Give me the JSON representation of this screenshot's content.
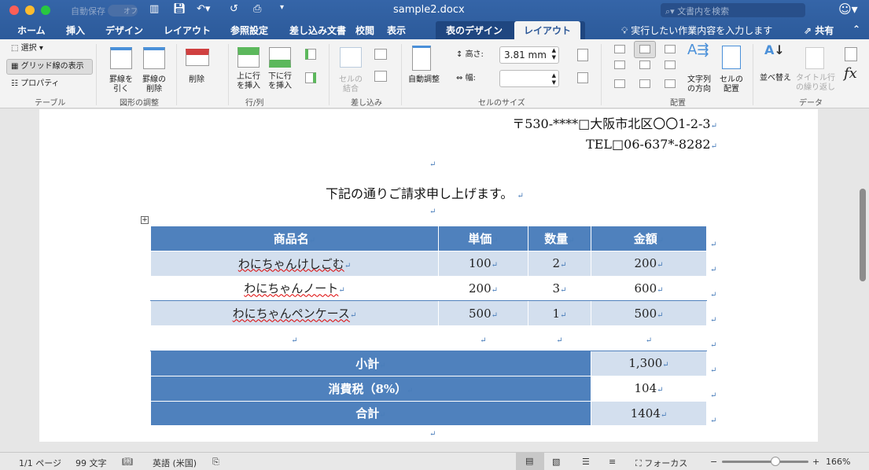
{
  "window": {
    "title": "sample2.docx",
    "autosave_label": "自動保存",
    "autosave_state": "オフ",
    "search_placeholder": "文書内を検索"
  },
  "tabs": [
    "ホーム",
    "挿入",
    "デザイン",
    "レイアウト",
    "参照設定",
    "差し込み文書",
    "校閲",
    "表示",
    "表のデザイン",
    "レイアウト"
  ],
  "active_tab": "レイアウト",
  "tell_me": "実行したい作業内容を入力します",
  "share": "共有",
  "ribbon": {
    "table": {
      "select": "選択",
      "gridlines": "グリッド線の表示",
      "properties": "プロパティ",
      "group": "テーブル"
    },
    "draw": {
      "draw_borders": "罫線を引く",
      "erase_borders": "罫線の削除",
      "group": "図形の調整"
    },
    "rows": {
      "delete": "削除",
      "insert_above": "上に行を挿入",
      "insert_below": "下に行を挿入",
      "group": "行/列"
    },
    "merge": {
      "merge_cells": "セルの結合",
      "group": "差し込み"
    },
    "size": {
      "autofit": "自動調整",
      "height_label": "高さ:",
      "height_value": "3.81 mm",
      "width_label": "幅:",
      "width_value": "",
      "group": "セルのサイズ"
    },
    "align": {
      "text_direction": "文字列の方向",
      "cell_margins": "セルの配置",
      "group": "配置"
    },
    "data": {
      "sort": "並べ替え",
      "repeat_header": "タイトル行の繰り返し",
      "formula": "fx",
      "group": "データ"
    }
  },
  "document": {
    "address": "〒530-****□大阪市北区〇〇1-2-3",
    "tel": "TEL□06-637*-8282",
    "intro": "下記の通りご請求申し上げます。",
    "table": {
      "headers": [
        "商品名",
        "単価",
        "数量",
        "金額"
      ],
      "rows": [
        [
          "わにちゃんけしごむ",
          "100",
          "2",
          "200"
        ],
        [
          "わにちゃんノート",
          "200",
          "3",
          "600"
        ],
        [
          "わにちゃんペンケース",
          "500",
          "1",
          "500"
        ],
        [
          "",
          "",
          "",
          ""
        ]
      ],
      "subtotal_label": "小計",
      "subtotal": "1,300",
      "tax_label": "消費税（8%）",
      "tax": "104",
      "total_label": "合計",
      "total": "1404"
    }
  },
  "status": {
    "page": "1/1 ページ",
    "words": "99 文字",
    "language": "英語 (米国)",
    "focus": "フォーカス",
    "zoom": "166%",
    "zoom_fraction": 0.62
  },
  "colors": {
    "header": "#4f81bd",
    "band": "#d3dfee",
    "titlebar": "#2c5a9a"
  }
}
